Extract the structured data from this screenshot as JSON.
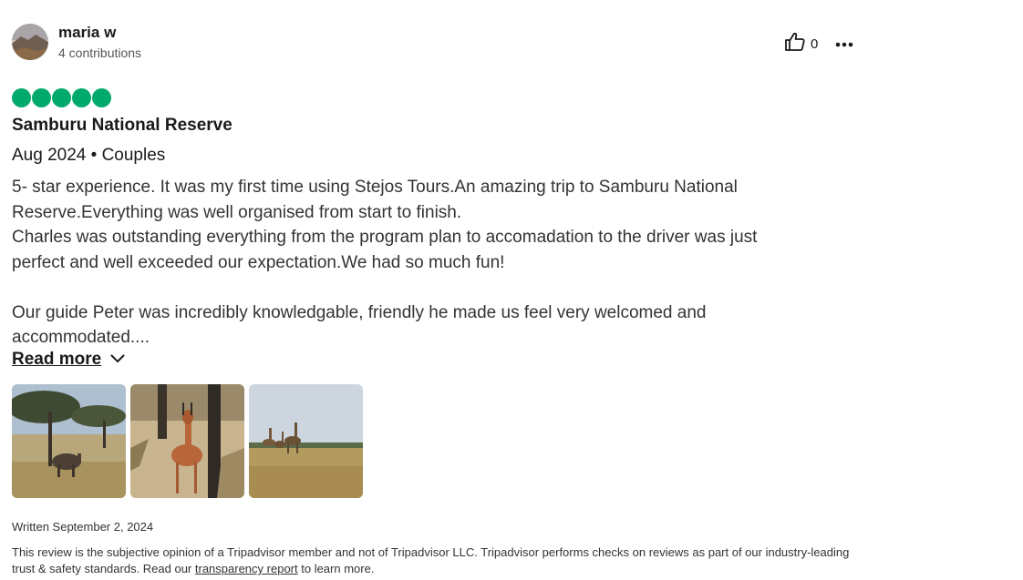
{
  "reviewer": {
    "name": "maria w",
    "contributions": "4 contributions"
  },
  "actions": {
    "helpful_count": "0",
    "helpful_icon": "thumbs-up-icon",
    "more_icon": "ellipsis-icon"
  },
  "rating": {
    "value": 5,
    "max": 5,
    "color": "#00aa6c"
  },
  "review": {
    "title": "Samburu National Reserve",
    "meta": "Aug 2024 • Couples",
    "lines": [
      "5- star experience. It was my first time using Stejos Tours.An amazing trip to Samburu National",
      "Reserve.Everything was well organised from start to finish.",
      "Charles was outstanding everything from the program plan to accomadation to the driver was just",
      "perfect and well exceeded our expectation.We had so much fun!",
      "Our guide Peter was incredibly knowledgable, friendly he made us feel very welcomed and",
      "accommodated...."
    ],
    "read_more": "Read more",
    "read_more_icon": "chevron-down-icon"
  },
  "photos": [
    "waterbuck-under-acacia-photo",
    "gerenuk-among-trees-photo",
    "giraffes-on-savanna-photo"
  ],
  "footer": {
    "written": "Written September 2, 2024",
    "disclaimer_part1": "This review is the subjective opinion of a Tripadvisor member and not of Tripadvisor LLC. Tripadvisor performs checks on reviews as part of our industry-leading trust & safety standards. Read our ",
    "disclaimer_link": "transparency report",
    "disclaimer_part2": " to learn more."
  }
}
